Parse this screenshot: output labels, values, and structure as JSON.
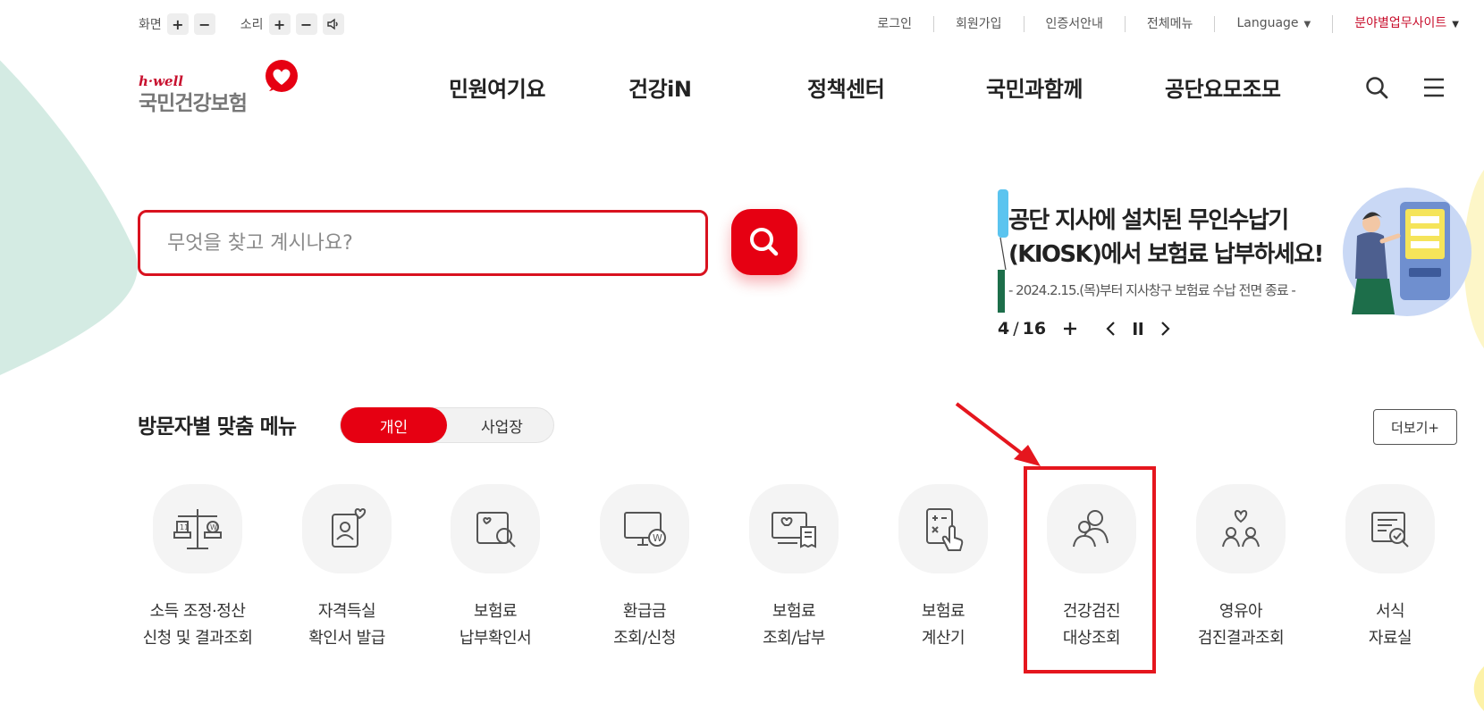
{
  "utility": {
    "screen_label": "화면",
    "sound_label": "소리",
    "plus": "+",
    "minus": "−"
  },
  "top_links": [
    {
      "label": "로그인"
    },
    {
      "label": "회원가입"
    },
    {
      "label": "인증서안내"
    },
    {
      "label": "전체메뉴"
    },
    {
      "label": "Language",
      "caret": "▼"
    },
    {
      "label": "분야별업무사이트",
      "caret": "▼"
    }
  ],
  "logo": {
    "small": "h·well",
    "main": "국민건강보험"
  },
  "gnb": [
    {
      "label": "민원여기요"
    },
    {
      "label": "건강iN"
    },
    {
      "label": "정책센터"
    },
    {
      "label": "국민과함께"
    },
    {
      "label": "공단요모조모"
    }
  ],
  "search": {
    "placeholder": "무엇을 찾고 계시나요?",
    "value": ""
  },
  "banner": {
    "title_line1": "공단 지사에 설치된 무인수납기",
    "title_line2": "(KIOSK)에서 보험료 납부하세요!",
    "subtitle": "- 2024.2.15.(목)부터 지사창구 보험료 수납 전면 종료 -",
    "current": "4",
    "separator": "/",
    "total": "16",
    "plus": "+"
  },
  "visitor_menu": {
    "title": "방문자별 맞춤 메뉴",
    "toggle_active": "개인",
    "toggle_inactive": "사업장",
    "more": "더보기+"
  },
  "quick_menu": [
    {
      "line1": "소득 조정·정산",
      "line2": "신청 및 결과조회",
      "icon": "scale-icon"
    },
    {
      "line1": "자격득실",
      "line2": "확인서 발급",
      "icon": "id-card-heart-icon"
    },
    {
      "line1": "보험료",
      "line2": "납부확인서",
      "icon": "document-search-icon"
    },
    {
      "line1": "환급금",
      "line2": "조회/신청",
      "icon": "monitor-won-icon"
    },
    {
      "line1": "보험료",
      "line2": "조회/납부",
      "icon": "monitor-receipt-icon"
    },
    {
      "line1": "보험료",
      "line2": "계산기",
      "icon": "calculator-hand-icon"
    },
    {
      "line1": "건강검진",
      "line2": "대상조회",
      "icon": "people-icon"
    },
    {
      "line1": "영유아",
      "line2": "검진결과조회",
      "icon": "family-heart-icon"
    },
    {
      "line1": "서식",
      "line2": "자료실",
      "icon": "form-search-icon"
    }
  ],
  "colors": {
    "brand_red": "#e60012",
    "annotation_red": "#e5161e",
    "blob_green": "#d4ebe3",
    "blob_yellow": "#fdf6c8"
  }
}
